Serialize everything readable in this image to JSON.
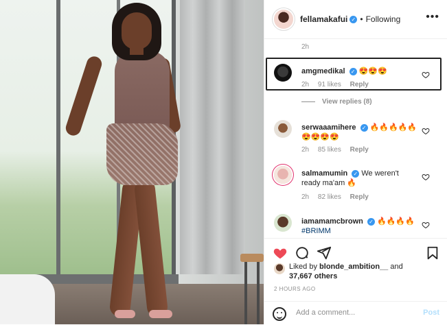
{
  "post": {
    "photo_icon": "person-photo",
    "header": {
      "username": "fellamakafui",
      "verified_icon": "verified-check-icon",
      "separator": "•",
      "follow_status": "Following",
      "more_icon": "more-horizontal-icon"
    },
    "comments": {
      "top_time": "2h",
      "items": [
        {
          "username": "amgmedikal",
          "text": "😍😍😍",
          "time": "2h",
          "likes": "91 likes",
          "reply_label": "Reply",
          "highlighted": true
        },
        {
          "username": "serwaaamihere",
          "text": "🔥🔥🔥🔥🔥 😍😍😍😍",
          "time": "2h",
          "likes": "85 likes",
          "reply_label": "Reply"
        },
        {
          "username": "salmamumin",
          "text": "We weren't ready ma'am 🔥",
          "time": "2h",
          "likes": "82 likes",
          "reply_label": "Reply"
        },
        {
          "username": "iamamamcbrown",
          "text": "🔥🔥🔥🔥 #BRIMM"
        }
      ],
      "view_replies": "View replies (8)"
    },
    "actions": {
      "like_icon": "heart-filled-icon",
      "comment_icon": "comment-icon",
      "share_icon": "share-icon",
      "save_icon": "bookmark-icon",
      "like_color": "#ed4956"
    },
    "likes": {
      "prefix": "Liked by",
      "user": "blonde_ambition__",
      "middle": "and",
      "count": "37,667 others"
    },
    "posted_time": "2 HOURS AGO",
    "add_comment": {
      "placeholder": "Add a comment...",
      "post_label": "Post",
      "emoji_icon": "emoji-icon"
    }
  }
}
